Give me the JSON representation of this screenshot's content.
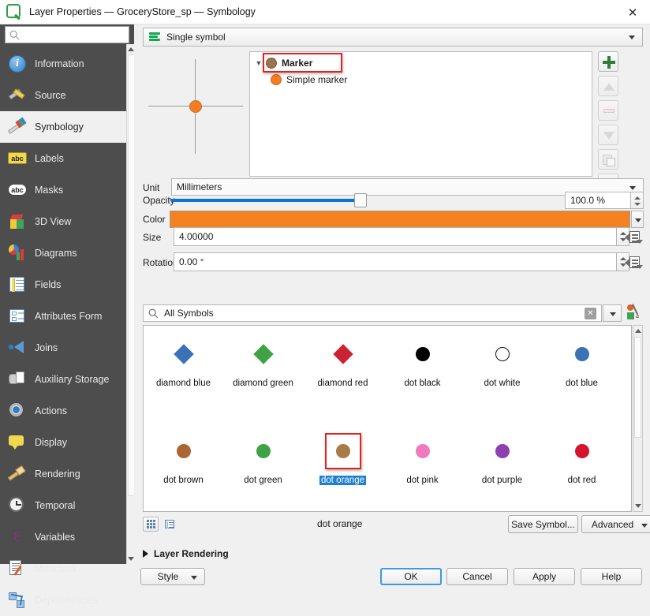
{
  "window": {
    "title": "Layer Properties — GroceryStore_sp — Symbology",
    "app_icon": "qgis-icon",
    "close_label": "✕"
  },
  "sidebar": {
    "search": {
      "value": "",
      "placeholder": "",
      "icon": "search-icon"
    },
    "items": [
      {
        "label": "Information",
        "icon": "information-icon"
      },
      {
        "label": "Source",
        "icon": "source-icon"
      },
      {
        "label": "Symbology",
        "icon": "symbology-icon",
        "active": true
      },
      {
        "label": "Labels",
        "icon": "labels-icon"
      },
      {
        "label": "Masks",
        "icon": "masks-icon"
      },
      {
        "label": "3D View",
        "icon": "3d-view-icon"
      },
      {
        "label": "Diagrams",
        "icon": "diagrams-icon"
      },
      {
        "label": "Fields",
        "icon": "fields-icon"
      },
      {
        "label": "Attributes Form",
        "icon": "attributes-form-icon"
      },
      {
        "label": "Joins",
        "icon": "joins-icon"
      },
      {
        "label": "Auxiliary Storage",
        "icon": "auxiliary-storage-icon"
      },
      {
        "label": "Actions",
        "icon": "actions-icon"
      },
      {
        "label": "Display",
        "icon": "display-icon"
      },
      {
        "label": "Rendering",
        "icon": "rendering-icon"
      },
      {
        "label": "Temporal",
        "icon": "temporal-icon"
      },
      {
        "label": "Variables",
        "icon": "variables-icon"
      },
      {
        "label": "Metadata",
        "icon": "metadata-icon"
      },
      {
        "label": "Dependencies",
        "icon": "dependencies-icon"
      }
    ]
  },
  "renderer": {
    "selected": "Single symbol",
    "icon": "single-symbol-icon"
  },
  "symbol_tree": {
    "nodes": [
      {
        "label": "Marker",
        "dot": "brown",
        "bold": true,
        "highlighted": true
      },
      {
        "label": "Simple marker",
        "dot": "orange",
        "bold": false,
        "highlighted": false
      }
    ],
    "buttons": [
      {
        "name": "add-symbol-layer",
        "icon": "plus-icon",
        "enabled": true
      },
      {
        "name": "move-up",
        "icon": "arrow-up-icon",
        "enabled": false
      },
      {
        "name": "remove-symbol-layer",
        "icon": "minus-icon",
        "enabled": false
      },
      {
        "name": "move-down",
        "icon": "arrow-down-icon",
        "enabled": false
      },
      {
        "name": "duplicate-layer",
        "icon": "duplicate-icon",
        "enabled": false
      },
      {
        "name": "lock-layer",
        "icon": "lock-icon",
        "enabled": false
      }
    ]
  },
  "properties": {
    "unit": {
      "label": "Unit",
      "value": "Millimeters"
    },
    "opacity": {
      "label": "Opacity",
      "value": "100.0 %",
      "percent": 100
    },
    "color": {
      "label": "Color",
      "value": "",
      "hex": "#f58220"
    },
    "size": {
      "label": "Size",
      "value": "4.00000"
    },
    "rotation": {
      "label": "Rotation",
      "value": "0.00 °"
    }
  },
  "symbol_browser": {
    "search": {
      "value": "All Symbols",
      "icon": "search-icon",
      "clear_icon": "clear-icon"
    },
    "style_manager_icon": "style-manager-icon",
    "rows": [
      [
        {
          "label": "diamond blue",
          "shape": "diamond",
          "color": "#3a72b5",
          "selected": false
        },
        {
          "label": "diamond green",
          "shape": "diamond",
          "color": "#3fa345",
          "selected": false
        },
        {
          "label": "diamond red",
          "shape": "diamond",
          "color": "#cc2233",
          "selected": false
        },
        {
          "label": "dot  black",
          "shape": "dot",
          "color": "#000000",
          "selected": false
        },
        {
          "label": "dot  white",
          "shape": "dot",
          "color": "#ffffff",
          "selected": false
        },
        {
          "label": "dot blue",
          "shape": "dot",
          "color": "#3a72b5",
          "selected": false
        }
      ],
      [
        {
          "label": "dot brown",
          "shape": "dot",
          "color": "#aa6633",
          "selected": false
        },
        {
          "label": "dot green",
          "shape": "dot",
          "color": "#3fa345",
          "selected": false
        },
        {
          "label": "dot orange",
          "shape": "dot",
          "color": "#a87a45",
          "selected": true
        },
        {
          "label": "dot pink",
          "shape": "dot",
          "color": "#f07ac0",
          "selected": false
        },
        {
          "label": "dot purple",
          "shape": "dot",
          "color": "#8e3fb0",
          "selected": false
        },
        {
          "label": "dot red",
          "shape": "dot",
          "color": "#d4142e",
          "selected": false
        }
      ]
    ]
  },
  "bottom_bar": {
    "view_grid_icon": "grid-view-icon",
    "view_list_icon": "list-view-icon",
    "current_symbol": "dot orange",
    "save_symbol_label": "Save Symbol...",
    "advanced_label": "Advanced"
  },
  "layer_rendering": {
    "label": "Layer Rendering",
    "expanded": false
  },
  "dialog_buttons": {
    "style": "Style",
    "ok": "OK",
    "cancel": "Cancel",
    "apply": "Apply",
    "help": "Help"
  }
}
